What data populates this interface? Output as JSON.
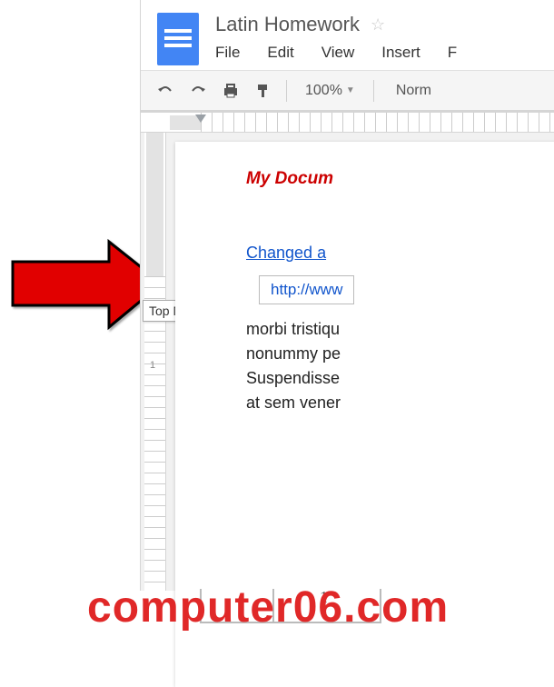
{
  "header": {
    "title": "Latin Homework",
    "menu": {
      "file": "File",
      "edit": "Edit",
      "view": "View",
      "insert": "Insert",
      "format_partial": "F"
    }
  },
  "toolbar": {
    "zoom": "100%",
    "style_partial": "Norm"
  },
  "rulers": {
    "vertical_number": "1"
  },
  "document": {
    "heading_partial": "My Docum",
    "link_heading_partial": "Changed a",
    "url_partial": "http://www",
    "body_line1": "morbi tristiqu",
    "body_line2": "nonummy pe",
    "body_line3": "Suspendisse",
    "body_line4": "at sem vener"
  },
  "tooltip": {
    "label": "Top Margin"
  },
  "footer": {
    "page_number": "1",
    "watermark": "computer06.com"
  }
}
